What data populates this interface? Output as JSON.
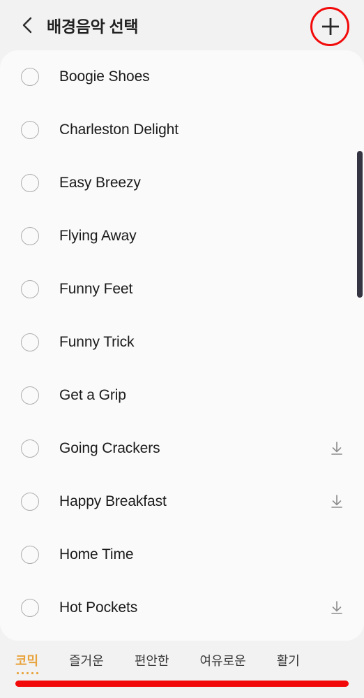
{
  "header": {
    "title": "배경음악 선택",
    "back_icon": "chevron-left-icon",
    "add_icon": "plus-icon"
  },
  "annotations": {
    "circle_color": "#f20a0a",
    "bar_color": "#f20a0a"
  },
  "list": {
    "radio_icon": "radio-unchecked-icon",
    "download_icon": "download-icon",
    "tracks": [
      {
        "title": "Boogie Shoes",
        "selected": false,
        "downloadable": false
      },
      {
        "title": "Charleston Delight",
        "selected": false,
        "downloadable": false
      },
      {
        "title": "Easy Breezy",
        "selected": false,
        "downloadable": false
      },
      {
        "title": "Flying Away",
        "selected": false,
        "downloadable": false
      },
      {
        "title": "Funny Feet",
        "selected": false,
        "downloadable": false
      },
      {
        "title": "Funny Trick",
        "selected": false,
        "downloadable": false
      },
      {
        "title": "Get a Grip",
        "selected": false,
        "downloadable": false
      },
      {
        "title": "Going Crackers",
        "selected": false,
        "downloadable": true
      },
      {
        "title": "Happy Breakfast",
        "selected": false,
        "downloadable": true
      },
      {
        "title": "Home Time",
        "selected": false,
        "downloadable": false
      },
      {
        "title": "Hot Pockets",
        "selected": false,
        "downloadable": true
      }
    ]
  },
  "tabs": {
    "active_color": "#e8a33d",
    "items": [
      {
        "label": "코믹",
        "active": true
      },
      {
        "label": "즐거운",
        "active": false
      },
      {
        "label": "편안한",
        "active": false
      },
      {
        "label": "여유로운",
        "active": false
      },
      {
        "label": "활기",
        "active": false
      }
    ]
  }
}
